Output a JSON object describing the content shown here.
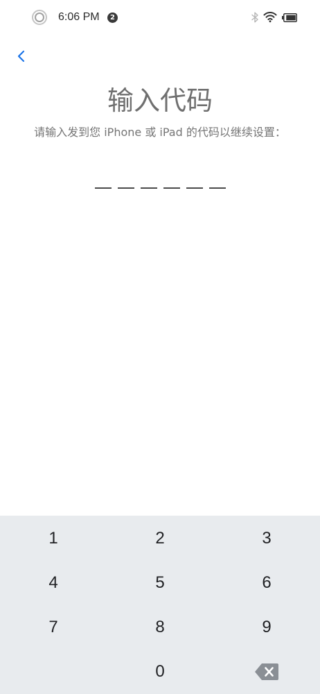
{
  "status_bar": {
    "time": "6:06 PM",
    "notification_count": "2",
    "battery_level_percent": 90,
    "icons": {
      "left": "screen-record-icon",
      "bluetooth": "bluetooth-icon",
      "wifi": "wifi-icon",
      "battery": "battery-icon"
    }
  },
  "nav": {
    "back_icon": "chevron-left-icon"
  },
  "main": {
    "title": "输入代码",
    "subtitle": "请输入发到您 iPhone 或 iPad 的代码以继续设置：",
    "code_digits": [
      "",
      "",
      "",
      "",
      "",
      ""
    ]
  },
  "keypad": {
    "rows": [
      [
        {
          "label": "1"
        },
        {
          "label": "2"
        },
        {
          "label": "3"
        }
      ],
      [
        {
          "label": "4"
        },
        {
          "label": "5"
        },
        {
          "label": "6"
        }
      ],
      [
        {
          "label": "7"
        },
        {
          "label": "8"
        },
        {
          "label": "9"
        }
      ],
      [
        {
          "label": ""
        },
        {
          "label": "0"
        },
        {
          "icon": "backspace-icon"
        }
      ]
    ]
  },
  "colors": {
    "accent": "#1a73e8",
    "title": "#6f6f6f",
    "subtitle": "#757575",
    "dash": "#4a4a4a",
    "keypad_bg": "#e8ebee",
    "badge": "#3a3a3a",
    "backspace": "#8a8f95",
    "key_text": "#202124"
  }
}
